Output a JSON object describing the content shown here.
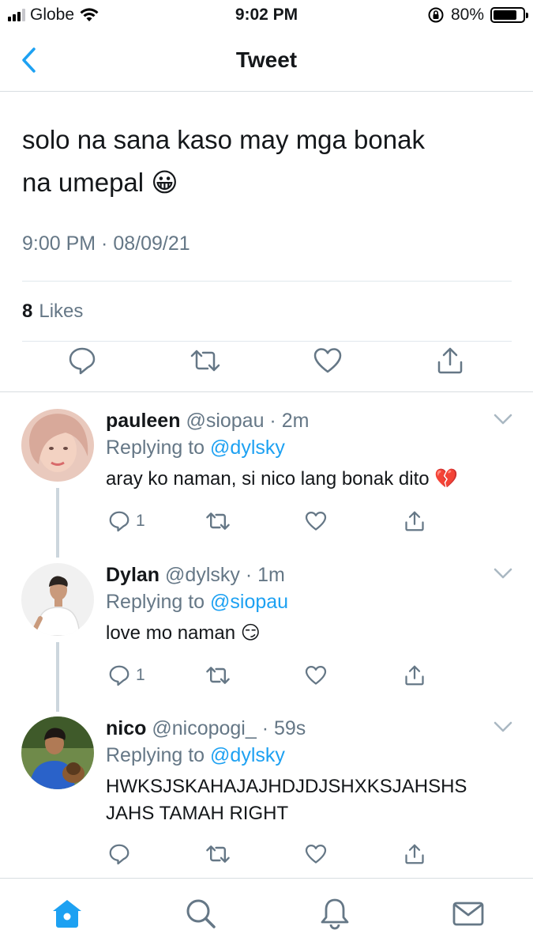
{
  "status_bar": {
    "carrier": "Globe",
    "time": "9:02 PM",
    "battery": "80%",
    "battery_level": 0.8
  },
  "nav": {
    "title": "Tweet"
  },
  "tweet": {
    "text_line1": "solo na sana kaso may mga bonak",
    "text_line2": "na umepal 😀",
    "timestamp": "9:00 PM · 08/09/21",
    "likes_count": "8",
    "likes_label": "Likes"
  },
  "replies": [
    {
      "name": "pauleen",
      "handle": "@siopau · 2m",
      "replying_prefix": "Replying to",
      "replying_to": "@dylsky",
      "text": "aray ko naman, si nico lang bonak dito 💔",
      "reply_count": "1"
    },
    {
      "name": "Dylan",
      "handle": "@dylsky · 1m",
      "replying_prefix": "Replying to",
      "replying_to": "@siopau",
      "text": "love mo naman 😏",
      "reply_count": "1"
    },
    {
      "name": "nico",
      "handle": "@nicopogi_ · 59s",
      "replying_prefix": "Replying to",
      "replying_to": "@dylsky",
      "text_line1": "HWKSJSKAHAJAJHDJDJSHXKSJAHSHS",
      "text_line2": "JAHS TAMAH RIGHT",
      "reply_count": ""
    }
  ],
  "colors": {
    "accent": "#1da1f2",
    "secondary_text": "#657786",
    "divider": "#e1e8ed"
  },
  "icons": {
    "back": "chevron-left-icon",
    "reply": "reply-bubble-icon",
    "retweet": "retweet-icon",
    "like": "heart-icon",
    "share": "share-icon",
    "more": "chevron-down-icon",
    "tabs": [
      "home-icon",
      "search-icon",
      "notifications-icon",
      "messages-icon"
    ]
  }
}
